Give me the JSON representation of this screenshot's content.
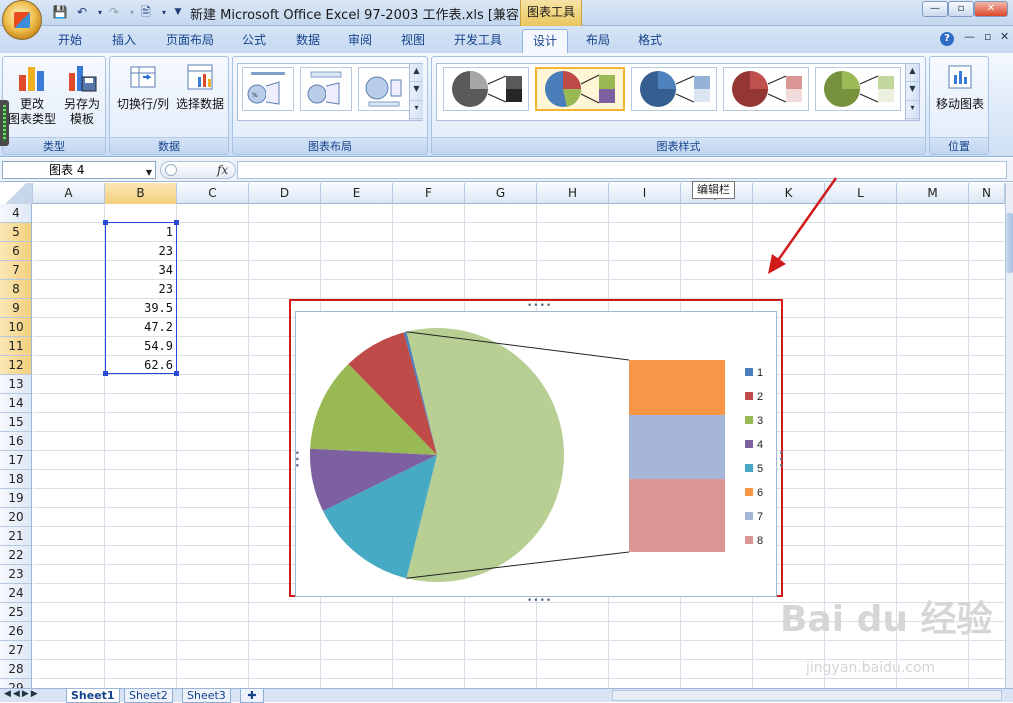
{
  "titlebar": {
    "title": "新建 Microsoft Office Excel 97-2003 工作表.xls  [兼容...",
    "context_tab": "图表工具",
    "minimize": "—",
    "restore": "▫",
    "close": "✕"
  },
  "tabs": [
    {
      "label": "开始"
    },
    {
      "label": "插入"
    },
    {
      "label": "页面布局"
    },
    {
      "label": "公式"
    },
    {
      "label": "数据"
    },
    {
      "label": "审阅"
    },
    {
      "label": "视图"
    },
    {
      "label": "开发工具"
    },
    {
      "label": "设计",
      "active": true
    },
    {
      "label": "布局"
    },
    {
      "label": "格式"
    }
  ],
  "ribbon": {
    "groups": {
      "type": "类型",
      "data": "数据",
      "layout": "图表布局",
      "styles": "图表样式",
      "location": "位置"
    },
    "buttons": {
      "change_type": "更改\n图表类型",
      "save_template": "另存为\n模板",
      "switch_row_col": "切换行/列",
      "select_data": "选择数据",
      "move_chart": "移动图表"
    }
  },
  "formula_bar": {
    "name_box": "图表 4",
    "fx": "fx",
    "tooltip": "编辑栏"
  },
  "columns": [
    "A",
    "B",
    "C",
    "D",
    "E",
    "F",
    "G",
    "H",
    "I",
    "J",
    "K",
    "L",
    "M",
    "N"
  ],
  "rows": [
    "4",
    "5",
    "6",
    "7",
    "8",
    "9",
    "10",
    "11",
    "12",
    "13",
    "14",
    "15",
    "16",
    "17",
    "18",
    "19",
    "20",
    "21",
    "22",
    "23",
    "24",
    "25",
    "26",
    "27",
    "28",
    "29"
  ],
  "cells_b": [
    "1",
    "23",
    "34",
    "23",
    "39.5",
    "47.2",
    "54.9",
    "62.6"
  ],
  "sheets": [
    "Sheet1",
    "Sheet2",
    "Sheet3"
  ],
  "chart_data": {
    "type": "pie",
    "subtype": "pie-of-bar",
    "categories": [
      "1",
      "2",
      "3",
      "4",
      "5",
      "6",
      "7",
      "8"
    ],
    "values": [
      1,
      23,
      34,
      23,
      39.5,
      47.2,
      54.9,
      62.6
    ],
    "secondary_categories": [
      "6",
      "7",
      "8"
    ],
    "colors": [
      "#4a7ebb",
      "#be4b48",
      "#98b954",
      "#7d60a0",
      "#46aac5",
      "#f79646",
      "#a5b6d9",
      "#d99694"
    ],
    "title": "",
    "legend_position": "right"
  },
  "watermark": {
    "text": "Bai du 经验",
    "url": "jingyan.baidu.com"
  }
}
